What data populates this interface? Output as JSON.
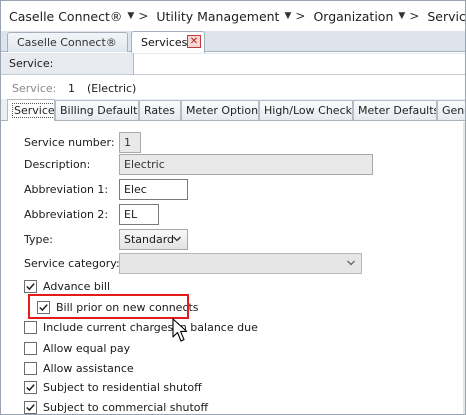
{
  "breadcrumb": [
    {
      "label": "Caselle Connect®"
    },
    {
      "label": "Utility Management"
    },
    {
      "label": "Organization"
    },
    {
      "label": "Services"
    }
  ],
  "breadcrumb_separator": ">",
  "doc_tabs": [
    {
      "label": "Caselle Connect®"
    },
    {
      "label": "Services",
      "close": "✕"
    }
  ],
  "search": {
    "label": "Service:",
    "value": ""
  },
  "info": {
    "label": "Service:",
    "number": "1",
    "name": "(Electric)"
  },
  "section_tabs": [
    "Service",
    "Billing Defaults",
    "Rates",
    "Meter Options",
    "High/Low Checks",
    "Meter Defaults",
    "Gene"
  ],
  "form": {
    "service_number": {
      "label": "Service number:",
      "value": "1"
    },
    "description": {
      "label": "Description:",
      "value": "Electric"
    },
    "abbrev1": {
      "label": "Abbreviation 1:",
      "value": "Elec"
    },
    "abbrev2": {
      "label": "Abbreviation 2:",
      "value": "EL"
    },
    "type": {
      "label": "Type:",
      "value": "Standard"
    },
    "category": {
      "label": "Service category:",
      "value": ""
    }
  },
  "checkboxes": [
    {
      "label": "Advance bill",
      "checked": true
    },
    {
      "label": "Bill prior on new connects",
      "checked": true
    },
    {
      "label": "Include current charges in balance due",
      "checked": false
    },
    {
      "label": "Allow equal pay",
      "checked": false
    },
    {
      "label": "Allow assistance",
      "checked": false
    },
    {
      "label": "Subject to residential shutoff",
      "checked": true
    },
    {
      "label": "Subject to commercial shutoff",
      "checked": true
    }
  ],
  "colors": {
    "highlight": "#e41b1b",
    "accent": "#dde4ec"
  }
}
